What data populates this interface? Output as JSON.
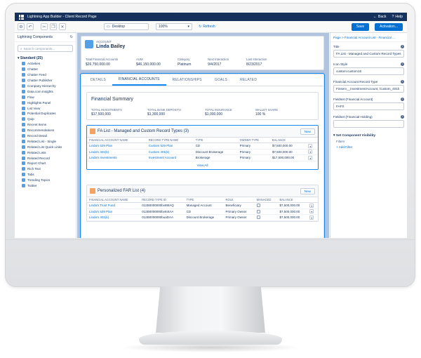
{
  "app": {
    "title": "Lightning App Builder - Client Record Page",
    "back_label": "Back",
    "help_label": "Help"
  },
  "toolbar": {
    "device": "Desktop",
    "zoom": "100%",
    "refresh": "Refresh",
    "save": "Save",
    "activation": "Activation..."
  },
  "left_panel": {
    "title": "Lightning Components",
    "search_placeholder": "Search components...",
    "section": "Standard (25)",
    "items": [
      "Activities",
      "Chatter",
      "Chatter Feed",
      "Chatter Publisher",
      "Company Hierarchy",
      "Data.com Insights",
      "Flow",
      "Highlights Panel",
      "List View",
      "Potential Duplicates",
      "Quip",
      "Recent Items",
      "Recommendations",
      "Record Detail",
      "Related List - Single",
      "Related List Quick Links",
      "Related Lists",
      "Related Record",
      "Report Chart",
      "Rich Text",
      "Tabs",
      "Trending Topics",
      "Twitter"
    ]
  },
  "record": {
    "object_label": "Account",
    "name": "Linda Bailey",
    "fields": [
      {
        "label": "Total Financial Accounts",
        "value": "$26,750,000.00"
      },
      {
        "label": "AUM",
        "value": "$46,150,000.00"
      },
      {
        "label": "Category",
        "value": "Platinum"
      },
      {
        "label": "Next Interaction",
        "value": "9/4/2017"
      },
      {
        "label": "Last Interaction",
        "value": "8/23/2017"
      }
    ]
  },
  "tabs": [
    "Details",
    "Financial Accounts",
    "Relationships",
    "Goals",
    "Related"
  ],
  "summary": {
    "title": "Financial Summary",
    "cols": [
      {
        "label": "Total Investments",
        "value": "$17,500,000"
      },
      {
        "label": "Total Bank Deposits",
        "value": "$1,300,000"
      },
      {
        "label": "Total Insurance",
        "value": "$1,000,000"
      },
      {
        "label": "Wallet Share",
        "value": "100 %"
      }
    ]
  },
  "fa_list": {
    "title": "FA List - Managed and Custom Record Types (3)",
    "new": "New",
    "headers": [
      "Financial Account Name",
      "Record Type Name",
      "Type",
      "Owner Type",
      "Balance"
    ],
    "rows": [
      [
        "Linda's 529 Plan",
        "Custom 529 Plan",
        "CD",
        "Primary",
        "$7,500,000.00"
      ],
      [
        "Linda's 401(k)",
        "Custom 401(k)",
        "Discount Brokerage",
        "Primary",
        "$7,500,000.00"
      ],
      [
        "Linda's Investments",
        "Investment Account",
        "Brokerage",
        "Primary",
        "$17,500,000.00"
      ]
    ],
    "view_all": "View All"
  },
  "far_list": {
    "title": "Personalized FAR List (4)",
    "new": "New",
    "headers": [
      "Financial Account Name",
      "Record Type ID",
      "Type",
      "Role",
      "Managed",
      "Balance"
    ],
    "rows": [
      [
        "Linda's Trust Fund",
        "012B0000000bv88IAQ",
        "Managed Account",
        "Beneficiary",
        "$7,500,000.00"
      ],
      [
        "Linda's 529 Plan",
        "012B0000000bv84IAA",
        "CD",
        "Primary Owner",
        "$7,500,000.00"
      ],
      [
        "Linda's 401(k)",
        "012B0000000buaDAA",
        "Discount Brokerage",
        "Primary Owner",
        "$7,500,000.00"
      ]
    ]
  },
  "right_panel": {
    "breadcrumb": "Page  >  Financial Account List - Financial ...",
    "fields": [
      {
        "label": "Title",
        "value": "FA List - Managed and Custom Record Types"
      },
      {
        "label": "Icon Style",
        "value": "custom:custom16"
      },
      {
        "label": "Financial Account Record Type",
        "value": "Finserv__InvestmentAccount, Custom_401k"
      },
      {
        "label": "Fieldset (Financial Account)",
        "value": "FAFS"
      },
      {
        "label": "Fieldset (Financial Holding)",
        "value": ""
      }
    ],
    "visibility": "Set Component Visibility",
    "filters": "Filters",
    "add_filter": "+ Add Filter"
  }
}
